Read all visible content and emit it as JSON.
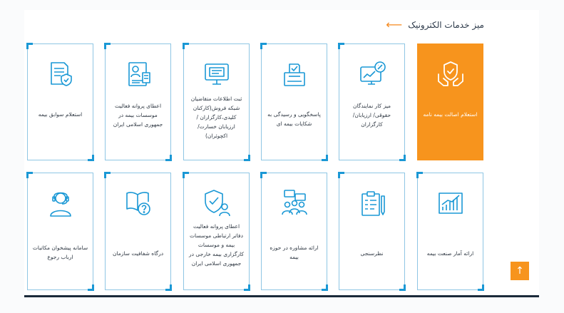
{
  "header": {
    "title": "میز خدمات الکترونیک",
    "arrow_icon": "arrow-left-icon",
    "accent_color": "#f5891f"
  },
  "cards_row1": [
    {
      "label": "استعلام اصالت بیمه نامه",
      "icon": "hands-shield-icon",
      "active": true
    },
    {
      "label": "میز کار نمایندگان حقوقی/ ارزیابان/ کارگزاران",
      "icon": "monitor-percent-icon",
      "active": false
    },
    {
      "label": "پاسخگویی و رسیدگی به شکایات بیمه ای",
      "icon": "ballot-box-icon",
      "active": false
    },
    {
      "label": "ثبت اطلاعات متقاضیان شبکه فروش(کارکنان کلیدی،کارگزاران / ارزیابان خسارت/ اکچوئران)",
      "icon": "computer-form-icon",
      "active": false
    },
    {
      "label": "اعطای پروانه فعالیت موسسات بیمه در جمهوری اسلامی ایران",
      "icon": "id-card-icon",
      "active": false
    },
    {
      "label": "استعلام سوابق بیمه",
      "icon": "document-shield-icon",
      "active": false
    }
  ],
  "cards_row2": [
    {
      "label": "ارائه آمار صنعت بیمه",
      "icon": "chart-growth-icon"
    },
    {
      "label": "نظرسنجی",
      "icon": "survey-clipboard-icon"
    },
    {
      "label": "ارائه مشاوره در حوزه بیمه",
      "icon": "consultation-group-icon"
    },
    {
      "label": "اعطای پروانه فعالیت دفاتر ارتباطی موسسات بیمه و موسسات کارگزاری بیمه خارجی در جمهوری اسلامی ایران",
      "icon": "shield-person-icon"
    },
    {
      "label": "درگاه شفافیت سازمان",
      "icon": "book-question-icon"
    },
    {
      "label": "سامانه پیشخوان مکاتبات ارباب رجوع",
      "icon": "headset-agent-icon"
    }
  ],
  "scroll_top": {
    "icon": "arrow-up-icon",
    "label": "↑"
  },
  "colors": {
    "accent": "#f7941d",
    "border": "#8fc6e4",
    "corner": "#1a98d5",
    "icon": "#1a98d5"
  }
}
